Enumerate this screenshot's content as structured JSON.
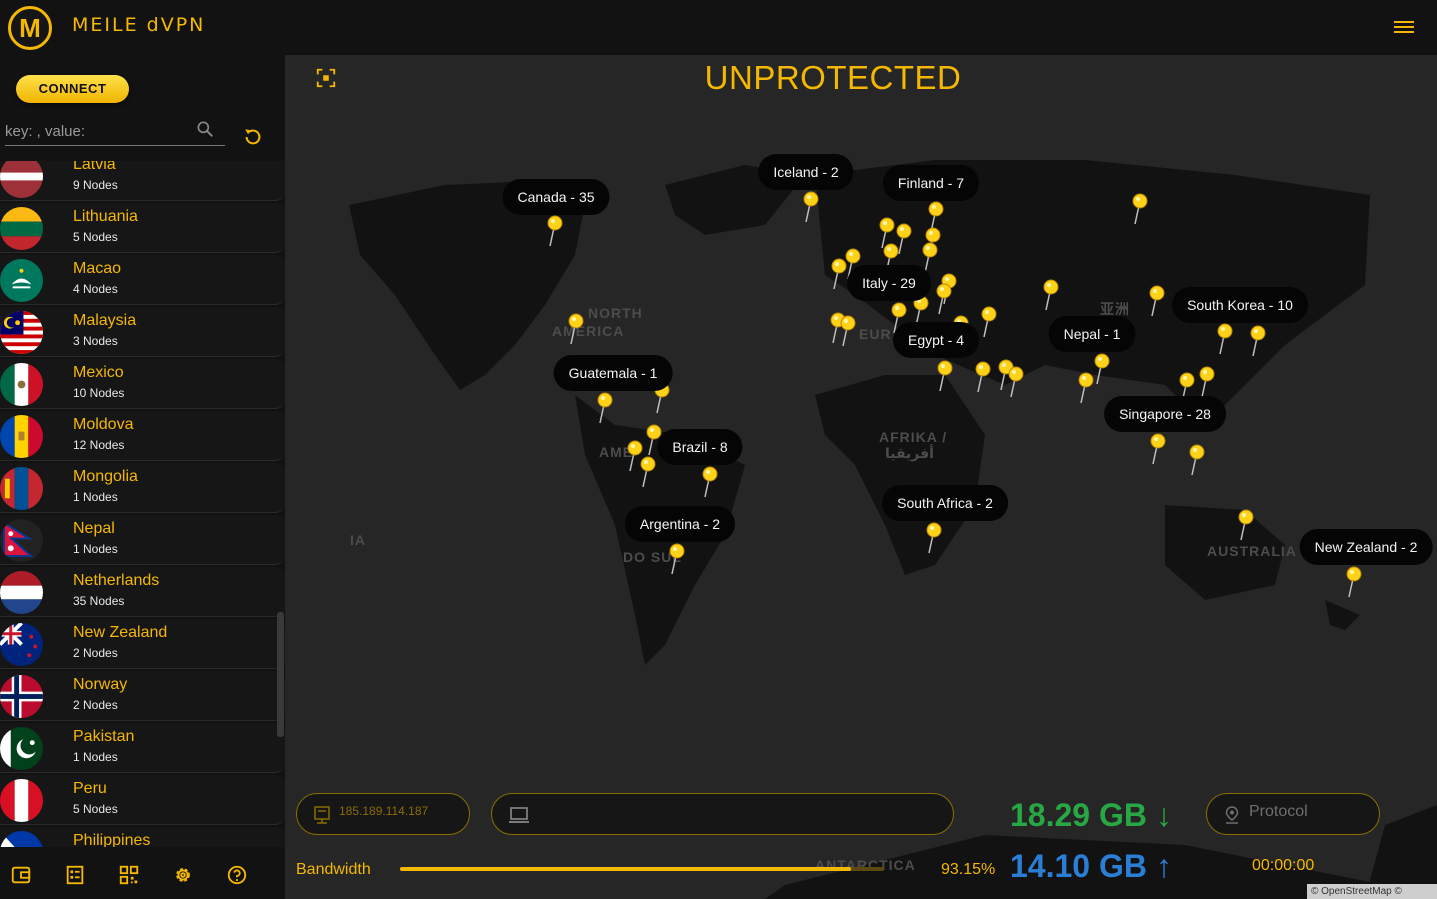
{
  "app": {
    "logo_letter": "M",
    "brand": "MEILE dVPN"
  },
  "sidebar": {
    "connect_label": "CONNECT",
    "search_placeholder": "key: , value:",
    "countries": [
      {
        "name": "Latvia",
        "nodes": "9 Nodes"
      },
      {
        "name": "Lithuania",
        "nodes": "5 Nodes"
      },
      {
        "name": "Macao",
        "nodes": "4 Nodes"
      },
      {
        "name": "Malaysia",
        "nodes": "3 Nodes"
      },
      {
        "name": "Mexico",
        "nodes": "10 Nodes"
      },
      {
        "name": "Moldova",
        "nodes": "12 Nodes"
      },
      {
        "name": "Mongolia",
        "nodes": "1 Nodes"
      },
      {
        "name": "Nepal",
        "nodes": "1 Nodes"
      },
      {
        "name": "Netherlands",
        "nodes": "35 Nodes"
      },
      {
        "name": "New Zealand",
        "nodes": "2 Nodes"
      },
      {
        "name": "Norway",
        "nodes": "2 Nodes"
      },
      {
        "name": "Pakistan",
        "nodes": "1 Nodes"
      },
      {
        "name": "Peru",
        "nodes": "5 Nodes"
      },
      {
        "name": "Philippines",
        "nodes": ""
      }
    ]
  },
  "map": {
    "status": "UNPROTECTED",
    "tooltips": [
      "Canada - 35",
      "Iceland - 2",
      "Finland - 7",
      "Italy - 29",
      "Egypt - 4",
      "Nepal - 1",
      "South Korea - 10",
      "Guatemala - 1",
      "Brazil - 8",
      "Singapore - 28",
      "South Africa - 2",
      "Argentina - 2",
      "New Zealand - 2"
    ],
    "labels": [
      "NORTH",
      "AMERICA",
      "EUR",
      "亚洲",
      "AFRIKA /",
      "أفريقيا",
      "AME",
      "DO SUL",
      "AUSTRALIA",
      "ANTARCTICA",
      "IA"
    ],
    "attribution": "© OpenStreetMap © CARTO"
  },
  "connection": {
    "ip": "185.189.114.187",
    "device": "",
    "protocol": "Protocol",
    "download": "18.29 GB ↓",
    "upload": "14.10 GB ↑",
    "bandwidth_label": "Bandwidth",
    "bandwidth_pct": "93.15%",
    "bandwidth_fraction": 0.9315,
    "timer": "00:00:00"
  },
  "colors": {
    "accent": "#f5b800",
    "download": "#28a745",
    "upload": "#2a7ed6"
  }
}
